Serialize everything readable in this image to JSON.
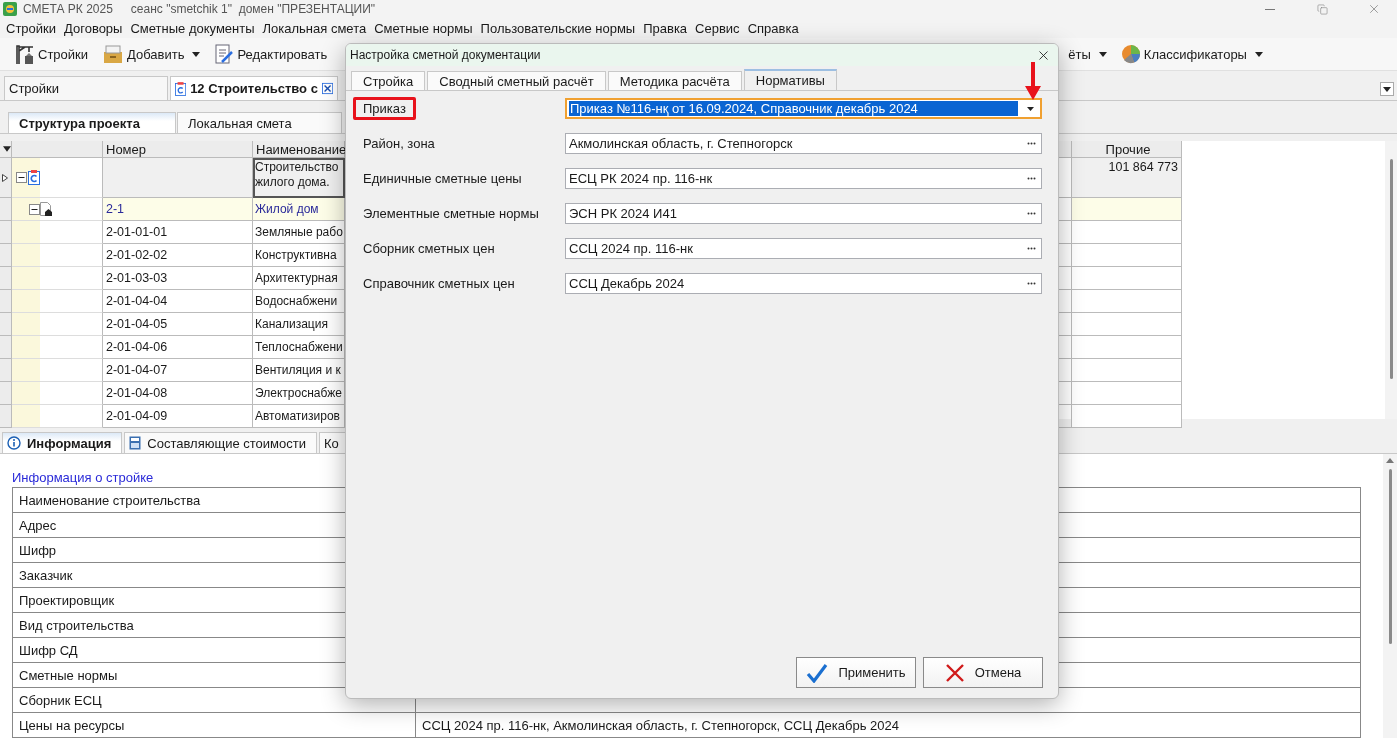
{
  "app": {
    "title": "СМЕТА РК 2025",
    "session": "сеанс \"smetchik 1\"  домен \"ПРЕЗЕНТАЦИИ\""
  },
  "menu": [
    "Стройки",
    "Договоры",
    "Сметные документы",
    "Локальная смета",
    "Сметные нормы",
    "Пользовательские нормы",
    "Правка",
    "Сервис",
    "Справка"
  ],
  "toolbar_groups": [
    [
      {
        "label": "Стройки",
        "dropdown": false
      },
      {
        "label": "Добавить",
        "dropdown": true
      },
      {
        "label": "Редактировать",
        "dropdown": false
      }
    ],
    [
      {
        "label": "ёты",
        "dropdown": true
      },
      {
        "label": "Классификаторы",
        "dropdown": true
      }
    ]
  ],
  "doc_tabs": [
    {
      "label": "Стройки",
      "selected": false
    },
    {
      "label": "12 Строительство с",
      "selected": true
    }
  ],
  "view_tabs": [
    {
      "label": "Структура проекта",
      "selected": true
    },
    {
      "label": "Локальная смета",
      "selected": false
    }
  ],
  "grid": {
    "columns": [
      "Номер",
      "Наименование",
      "Прочие"
    ],
    "rows": [
      {
        "kind": "project",
        "current": true,
        "expanded": true,
        "number": "",
        "name": "Строительство жилого дома.",
        "other": "101 864 773"
      },
      {
        "kind": "object",
        "current": false,
        "expanded": true,
        "number": "2-1",
        "name": "Жилой дом",
        "other": ""
      },
      {
        "kind": "estimate",
        "current": false,
        "number": "2-01-01-01",
        "name": "Земляные рабо",
        "other": ""
      },
      {
        "kind": "estimate",
        "current": false,
        "number": "2-01-02-02",
        "name": "Конструктивна",
        "other": ""
      },
      {
        "kind": "estimate",
        "current": false,
        "number": "2-01-03-03",
        "name": "Архитектурная",
        "other": ""
      },
      {
        "kind": "estimate",
        "current": false,
        "number": "2-01-04-04",
        "name": "Водоснабжени",
        "other": ""
      },
      {
        "kind": "estimate",
        "current": false,
        "number": "2-01-04-05",
        "name": "Канализация",
        "other": ""
      },
      {
        "kind": "estimate",
        "current": false,
        "number": "2-01-04-06",
        "name": "Теплоснабжени",
        "other": ""
      },
      {
        "kind": "estimate",
        "current": false,
        "number": "2-01-04-07",
        "name": "Вентиляция и к",
        "other": ""
      },
      {
        "kind": "estimate",
        "current": false,
        "number": "2-01-04-08",
        "name": "Электроснабже",
        "other": ""
      },
      {
        "kind": "estimate",
        "current": false,
        "number": "2-01-04-09",
        "name": "Автоматизиров",
        "other": ""
      }
    ]
  },
  "bottom_tabs": [
    {
      "label": "Информация",
      "selected": true
    },
    {
      "label": "Составляющие стоимости",
      "selected": false
    },
    {
      "label": "Ко",
      "selected": false
    }
  ],
  "info": {
    "link": "Информация о стройке",
    "rows": [
      {
        "label": "Наименование строительства"
      },
      {
        "label": "Адрес"
      },
      {
        "label": "Шифр"
      },
      {
        "label": "Заказчик"
      },
      {
        "label": "Проектировщик"
      },
      {
        "label": "Вид строительства"
      },
      {
        "label": "Шифр СД"
      },
      {
        "label": "Сметные нормы"
      },
      {
        "label": "Сборник ЕСЦ"
      },
      {
        "label": "Цены на ресурсы",
        "value": "ССЦ 2024 пр. 116-нк, Акмолинская область, г. Степногорск, ССЦ Декабрь 2024"
      }
    ]
  },
  "dialog": {
    "title": "Настройка сметной документации",
    "tabs": [
      {
        "label": "Стройка",
        "selected": false
      },
      {
        "label": "Сводный сметный расчёт",
        "selected": false
      },
      {
        "label": "Методика расчёта",
        "selected": false
      },
      {
        "label": "Нормативы",
        "selected": true
      }
    ],
    "fields": [
      {
        "kind": "combo",
        "label": "Приказ",
        "value": "Приказ №116-нқ от 16.09.2024, Справочник декабрь 2024",
        "highlighted": true,
        "focused": true
      },
      {
        "kind": "picker",
        "label": "Район, зона",
        "value": "Акмолинская область, г. Степногорск",
        "highlighted": false,
        "focused": false
      },
      {
        "kind": "picker",
        "label": "Единичные сметные цены",
        "value": "ЕСЦ РК 2024 пр. 116-нк",
        "highlighted": false,
        "focused": false
      },
      {
        "kind": "picker",
        "label": "Элементные сметные нормы",
        "value": "ЭСН РК 2024 И41",
        "highlighted": false,
        "focused": false
      },
      {
        "kind": "picker",
        "label": "Сборник сметных цен",
        "value": "ССЦ 2024 пр. 116-нк",
        "highlighted": false,
        "focused": false
      },
      {
        "kind": "picker",
        "label": "Справочник сметных цен",
        "value": "ССЦ Декабрь 2024",
        "highlighted": false,
        "focused": false
      }
    ],
    "buttons": [
      {
        "kind": "apply",
        "label": "Применить"
      },
      {
        "kind": "cancel",
        "label": "Отмена"
      }
    ]
  }
}
